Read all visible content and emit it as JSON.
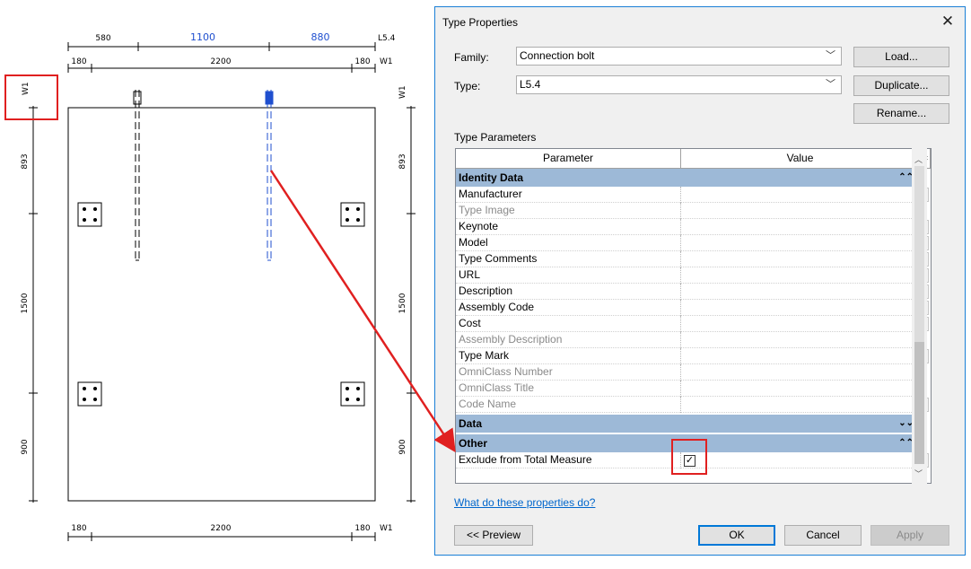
{
  "drawing": {
    "top_dims": {
      "row1": [
        "580",
        "1100",
        "880"
      ],
      "row1_label": "L5.4",
      "row2": [
        "180",
        "2200",
        "180"
      ],
      "row2_label": "W1"
    },
    "bottom_dims": {
      "row": [
        "180",
        "2200",
        "180"
      ],
      "label": "W1"
    },
    "left_dims": {
      "label": "W1",
      "values": [
        "893",
        "1500",
        "900"
      ]
    },
    "right_dims": {
      "label": "W1",
      "values": [
        "893",
        "1500",
        "900"
      ]
    }
  },
  "dialog": {
    "title": "Type Properties",
    "family_label": "Family:",
    "family_value": "Connection bolt",
    "type_label": "Type:",
    "type_value": "L5.4",
    "load_label": "Load...",
    "duplicate_label": "Duplicate...",
    "rename_label": "Rename...",
    "type_parameters_label": "Type Parameters",
    "col_parameter": "Parameter",
    "col_value": "Value",
    "col_eq": "=",
    "groups": {
      "identity": "Identity Data",
      "data": "Data",
      "other": "Other"
    },
    "identity_rows": [
      {
        "name": "Manufacturer"
      },
      {
        "name": "Type Image"
      },
      {
        "name": "Keynote"
      },
      {
        "name": "Model"
      },
      {
        "name": "Type Comments"
      },
      {
        "name": "URL"
      },
      {
        "name": "Description"
      },
      {
        "name": "Assembly Code"
      },
      {
        "name": "Cost"
      },
      {
        "name": "Assembly Description"
      },
      {
        "name": "Type Mark"
      },
      {
        "name": "OmniClass Number"
      },
      {
        "name": "OmniClass Title"
      },
      {
        "name": "Code Name"
      }
    ],
    "other_rows": [
      {
        "name": "Exclude from Total Measure",
        "checked": true
      }
    ],
    "help_link": "What do these properties do?",
    "preview_label": "<< Preview",
    "ok_label": "OK",
    "cancel_label": "Cancel",
    "apply_label": "Apply"
  },
  "colors": {
    "highlight": "#e02020",
    "group": "#9db9d7",
    "accent": "#0078d7",
    "bolt_selected": "#1f4fcf"
  }
}
